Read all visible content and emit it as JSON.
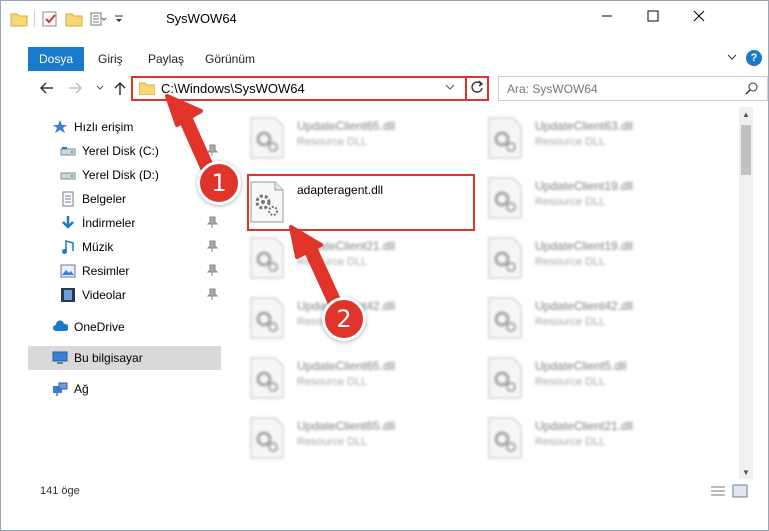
{
  "window": {
    "title": "SysWOW64"
  },
  "ribbon": {
    "tabs": [
      "Dosya",
      "Giriş",
      "Paylaş",
      "Görünüm"
    ]
  },
  "address": {
    "path": "C:\\Windows\\SysWOW64"
  },
  "search": {
    "placeholder": "Ara: SysWOW64"
  },
  "sidebar": {
    "items": [
      {
        "label": "Hızlı erişim",
        "icon": "star-icon"
      },
      {
        "label": "Yerel Disk (C:)",
        "icon": "drive-icon"
      },
      {
        "label": "Yerel Disk (D:)",
        "icon": "drive-icon"
      },
      {
        "label": "Belgeler",
        "icon": "documents-icon"
      },
      {
        "label": "İndirmeler",
        "icon": "download-icon"
      },
      {
        "label": "Müzik",
        "icon": "music-icon"
      },
      {
        "label": "Resimler",
        "icon": "pictures-icon"
      },
      {
        "label": "Videolar",
        "icon": "video-icon"
      },
      {
        "label": "OneDrive",
        "icon": "cloud-icon"
      },
      {
        "label": "Bu bilgisayar",
        "icon": "computer-icon"
      },
      {
        "label": "Ağ",
        "icon": "network-icon"
      }
    ]
  },
  "files": {
    "col1": [
      {
        "name": "UpdateClient65.dll",
        "type": "Resource DLL"
      },
      {
        "name": "adapteragent.dll",
        "type": ""
      },
      {
        "name": "UpdateClient21.dll",
        "type": "Resource DLL"
      },
      {
        "name": "UpdateClient42.dll",
        "type": "Resource DLL"
      },
      {
        "name": "UpdateClient65.dll",
        "type": "Resource DLL"
      },
      {
        "name": "UpdateClient65.dll",
        "type": "Resource DLL"
      }
    ],
    "col2": [
      {
        "name": "UpdateClient63.dll",
        "type": "Resource DLL"
      },
      {
        "name": "UpdateClient19.dll",
        "type": "Resource DLL"
      },
      {
        "name": "UpdateClient19.dll",
        "type": "Resource DLL"
      },
      {
        "name": "UpdateClient42.dll",
        "type": "Resource DLL"
      },
      {
        "name": "UpdateClient5.dll",
        "type": "Resource DLL"
      },
      {
        "name": "UpdateClient21.dll",
        "type": "Resource DLL"
      }
    ]
  },
  "annotations": {
    "step1": "1",
    "step2": "2"
  },
  "status": {
    "count": "141 öge"
  },
  "colors": {
    "accent": "#1979ca",
    "highlight": "#e0342b"
  }
}
